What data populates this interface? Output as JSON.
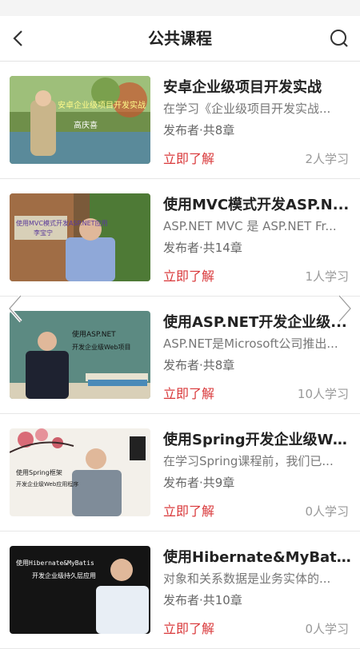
{
  "header": {
    "title": "公共课程",
    "back_icon": "chevron-left-icon",
    "search_icon": "search-icon"
  },
  "courses": [
    {
      "title": "安卓企业级项目开发实战",
      "description": "在学习《企业级项目开发实战...",
      "meta": "发布者·共8章",
      "action": "立即了解",
      "learners": "2人学习",
      "thumb_text": "安卓企业级项目开发实战",
      "thumb_sub": "高庆喜"
    },
    {
      "title": "使用MVC模式开发ASP.N...",
      "description": "ASP.NET MVC 是 ASP.NET Fr...",
      "meta": "发布者·共14章",
      "action": "立即了解",
      "learners": "1人学习",
      "thumb_text": "使用MVC模式开发ASP.NET应用",
      "thumb_sub": "李宝宁"
    },
    {
      "title": "使用ASP.NET开发企业级...",
      "description": "ASP.NET是Microsoft公司推出...",
      "meta": "发布者·共8章",
      "action": "立即了解",
      "learners": "10人学习",
      "thumb_text": "使用ASP.NET",
      "thumb_sub": "开发企业级Web项目"
    },
    {
      "title": "使用Spring开发企业级We...",
      "description": "在学习Spring课程前，我们已...",
      "meta": "发布者·共9章",
      "action": "立即了解",
      "learners": "0人学习",
      "thumb_text": "使用Spring框架",
      "thumb_sub": "开发企业级Web应用程序"
    },
    {
      "title": "使用Hibernate&MyBatis...",
      "description": "对象和关系数据是业务实体的...",
      "meta": "发布者·共10章",
      "action": "立即了解",
      "learners": "0人学习",
      "thumb_text": "使用Hibernate&MyBatis",
      "thumb_sub": "开发企业级持久层应用"
    }
  ],
  "carousel": {
    "prev_icon": "chevron-left-icon",
    "next_icon": "chevron-right-icon"
  },
  "colors": {
    "accent": "#d9383a",
    "muted": "#999999",
    "divider": "#e7e7e7"
  }
}
